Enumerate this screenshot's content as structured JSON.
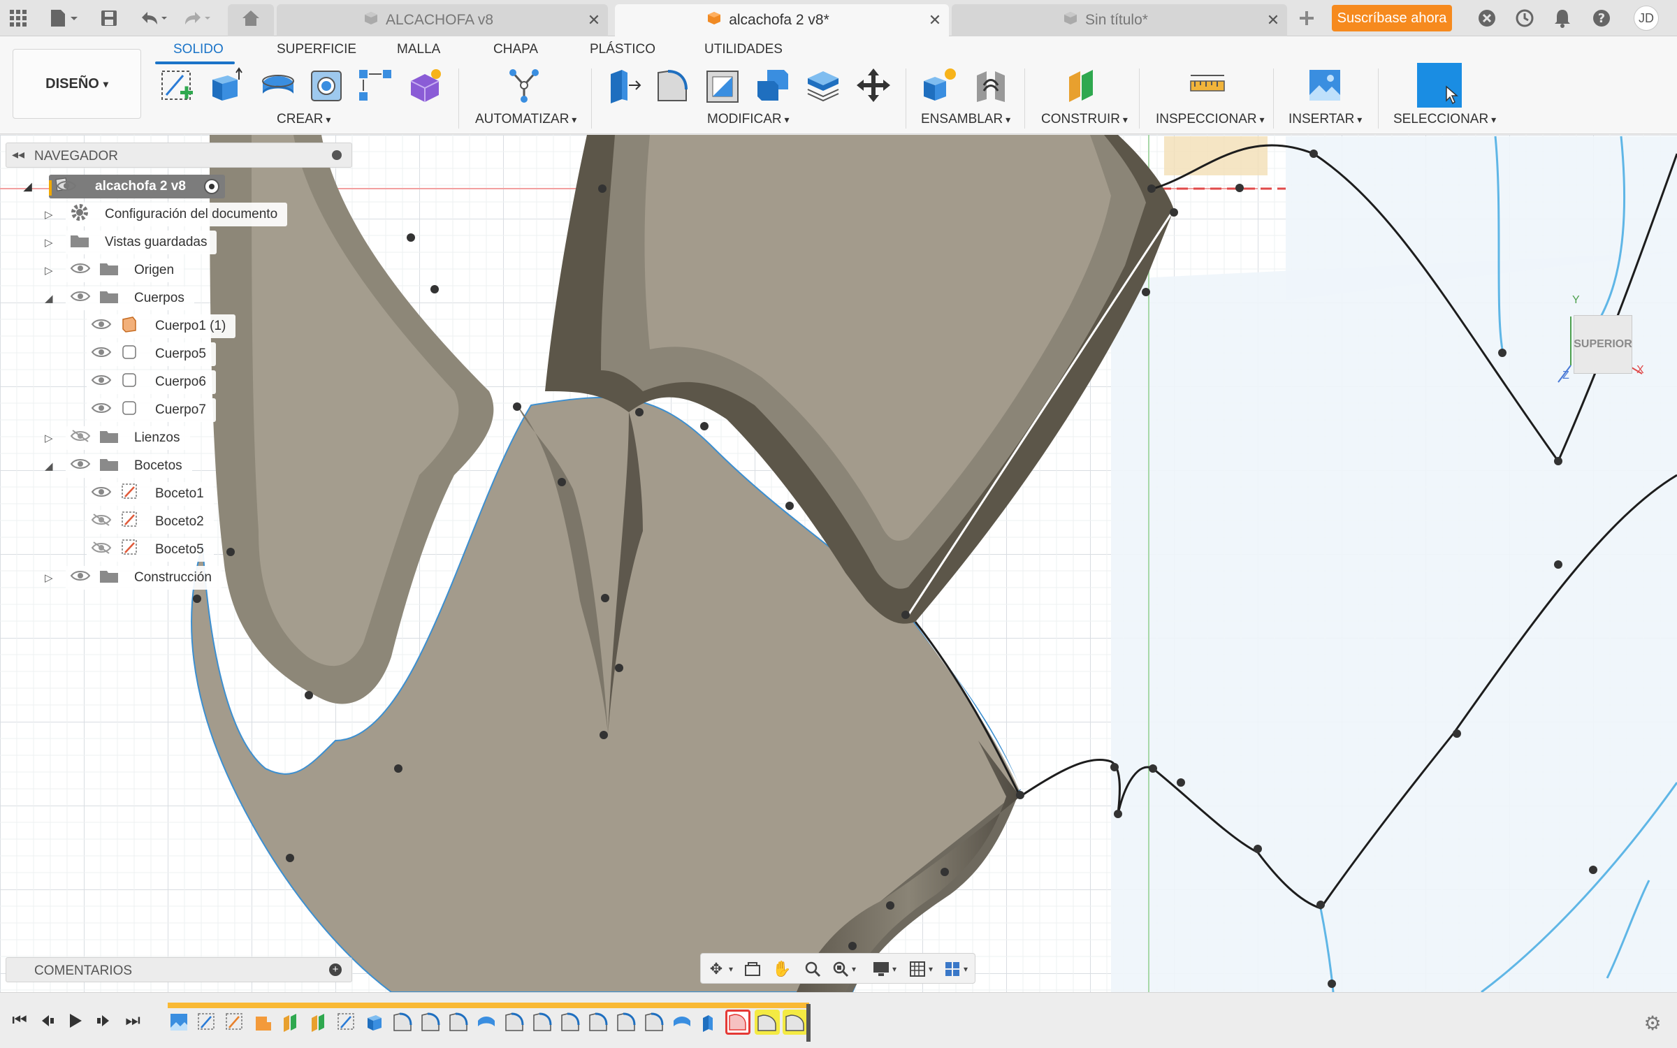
{
  "titlebar": {
    "tabs": [
      {
        "label": "ALCACHOFA v8",
        "active": false
      },
      {
        "label": "alcachofa 2 v8*",
        "active": true
      },
      {
        "label": "Sin título*",
        "active": false
      }
    ],
    "subscribe_label": "Suscríbase ahora",
    "user_initials": "JD"
  },
  "toolbar": {
    "workspace_label": "DISEÑO",
    "tabs": [
      "SOLIDO",
      "SUPERFICIE",
      "MALLA",
      "CHAPA",
      "PLÁSTICO",
      "UTILIDADES"
    ],
    "active_tab": "SOLIDO",
    "groups": [
      "CREAR",
      "AUTOMATIZAR",
      "MODIFICAR",
      "ENSAMBLAR",
      "CONSTRUIR",
      "INSPECCIONAR",
      "INSERTAR",
      "SELECCIONAR"
    ]
  },
  "navigator": {
    "title": "NAVEGADOR",
    "root": "alcachofa 2 v8",
    "items": [
      {
        "label": "Configuración del documento"
      },
      {
        "label": "Vistas guardadas"
      },
      {
        "label": "Origen"
      },
      {
        "label": "Cuerpos"
      },
      {
        "label": "Cuerpo1 (1)"
      },
      {
        "label": "Cuerpo5"
      },
      {
        "label": "Cuerpo6"
      },
      {
        "label": "Cuerpo7"
      },
      {
        "label": "Lienzos"
      },
      {
        "label": "Bocetos"
      },
      {
        "label": "Boceto1"
      },
      {
        "label": "Boceto2"
      },
      {
        "label": "Boceto5"
      },
      {
        "label": "Construcción"
      }
    ]
  },
  "comments": {
    "title": "COMENTARIOS"
  },
  "viewcube": {
    "face_label": "SUPERIOR",
    "axis_x": "X",
    "axis_y": "Y",
    "axis_z": "Z"
  },
  "colors": {
    "accent": "#1b74c8",
    "subscribe": "#f68a1e",
    "timeline": "#f9b934",
    "body": "#a39b8c"
  }
}
